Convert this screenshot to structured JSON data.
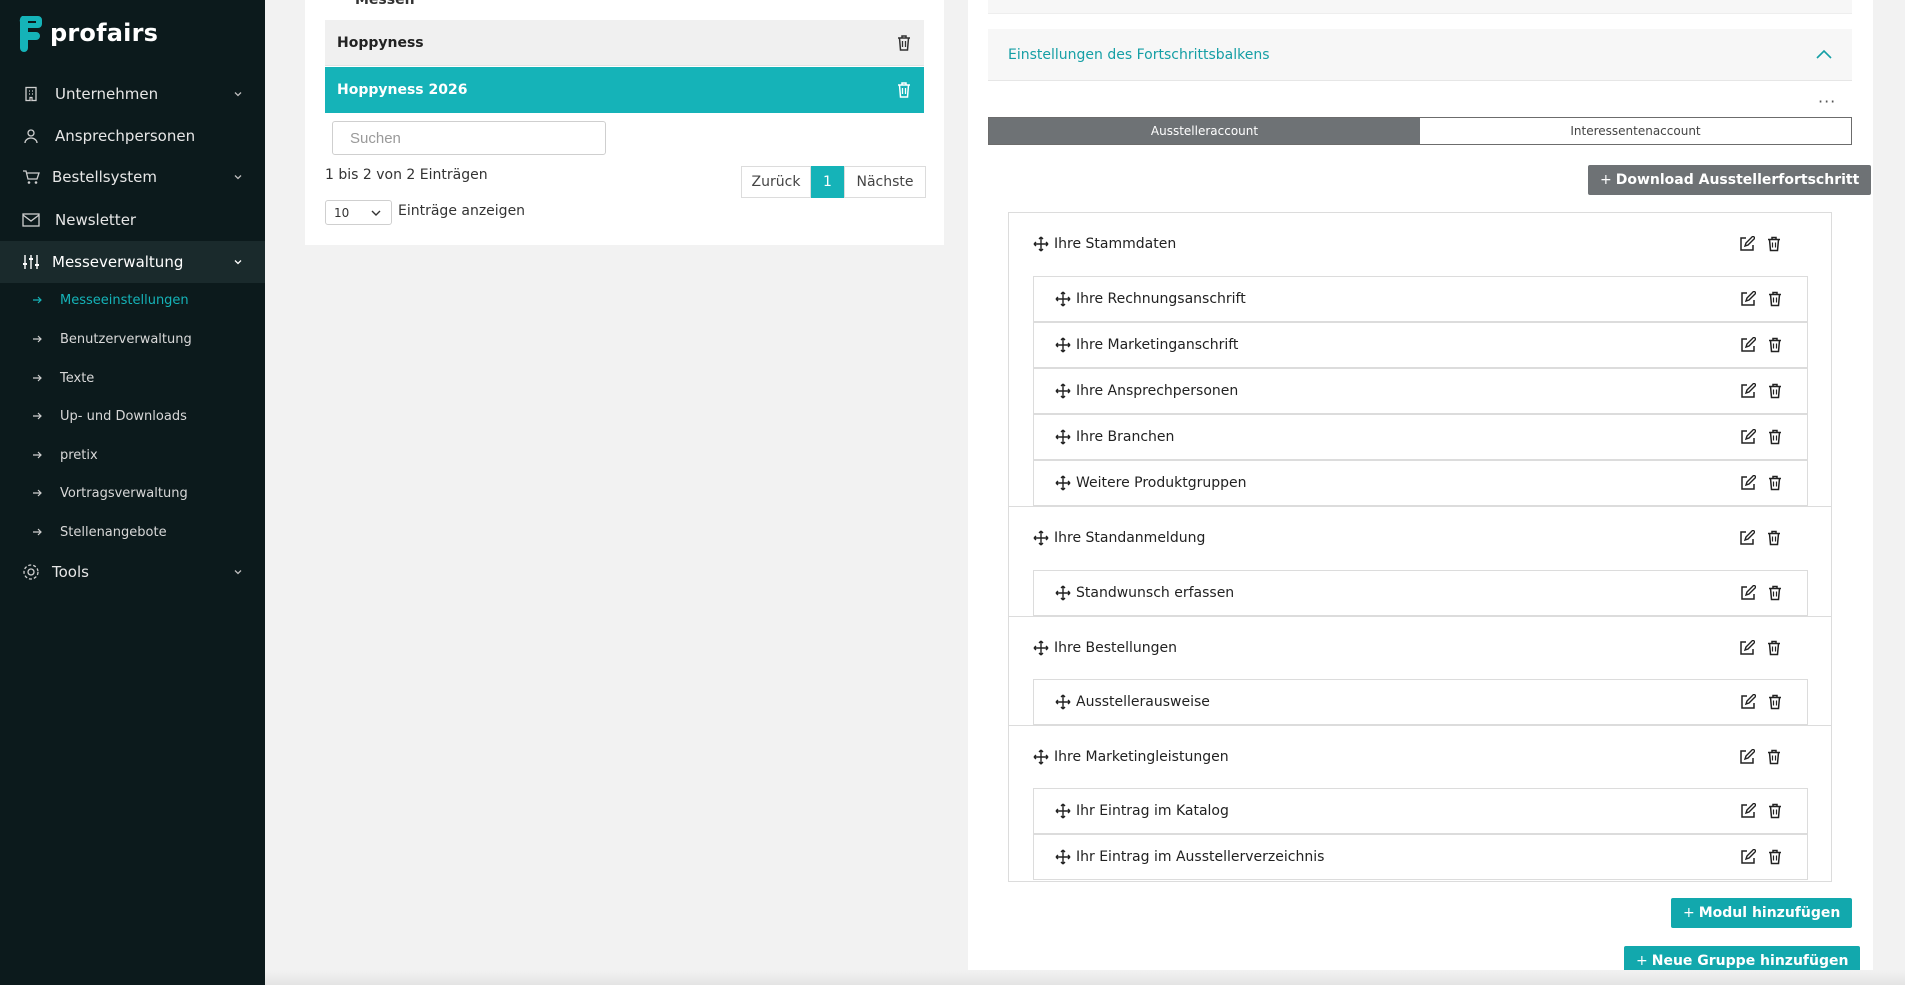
{
  "brand": {
    "name": "profairs",
    "accent": "#15b3b8",
    "sidebar_bg": "#0c1a1c"
  },
  "sidebar": {
    "items": [
      {
        "label": "Unternehmen",
        "icon": "building-icon",
        "has_chevron": true
      },
      {
        "label": "Ansprechpersonen",
        "icon": "user-icon",
        "has_chevron": false
      },
      {
        "label": "Bestellsystem",
        "icon": "cart-icon",
        "has_chevron": true
      },
      {
        "label": "Newsletter",
        "icon": "mail-icon",
        "has_chevron": false
      },
      {
        "label": "Messeverwaltung",
        "icon": "sliders-icon",
        "has_chevron": true,
        "active": true
      },
      {
        "label": "Tools",
        "icon": "gear-icon",
        "has_chevron": true
      }
    ],
    "subitems": [
      {
        "label": "Messeeinstellungen",
        "current": true
      },
      {
        "label": "Benutzerverwaltung"
      },
      {
        "label": "Texte"
      },
      {
        "label": "Up- und Downloads"
      },
      {
        "label": "pretix"
      },
      {
        "label": "Vortragsverwaltung"
      },
      {
        "label": "Stellenangebote"
      }
    ]
  },
  "fairs": {
    "clipped_header": "Messen",
    "rows": [
      {
        "name": "Hoppyness",
        "selected": false
      },
      {
        "name": "Hoppyness 2026",
        "selected": true
      }
    ],
    "search_placeholder": "Suchen",
    "info": "1 bis 2 von 2 Einträgen",
    "pager": {
      "prev": "Zurück",
      "page": "1",
      "next": "Nächste"
    },
    "page_length": "10",
    "page_length_label": "Einträge anzeigen"
  },
  "progress": {
    "accordion_title": "Einstellungen des Fortschrittsbalkens",
    "more": "···",
    "tabs": {
      "active": "Ausstelleraccount",
      "inactive": "Interessentenaccount"
    },
    "download_label": "Download Ausstellerfortschritt",
    "groups": [
      {
        "title": "Ihre Stammdaten",
        "items": [
          "Ihre Rechnungsanschrift",
          "Ihre Marketinganschrift",
          "Ihre Ansprechpersonen",
          "Ihre Branchen",
          "Weitere Produktgruppen"
        ]
      },
      {
        "title": "Ihre Standanmeldung",
        "items": [
          "Standwunsch erfassen"
        ]
      },
      {
        "title": "Ihre Bestellungen",
        "items": [
          "Ausstellerausweise"
        ]
      },
      {
        "title": "Ihre Marketingleistungen",
        "items": [
          "Ihr Eintrag im Katalog",
          "Ihr Eintrag im Ausstellerverzeichnis"
        ]
      }
    ],
    "add_module_label": "Modul hinzufügen",
    "add_group_label": "Neue Gruppe hinzufügen"
  }
}
